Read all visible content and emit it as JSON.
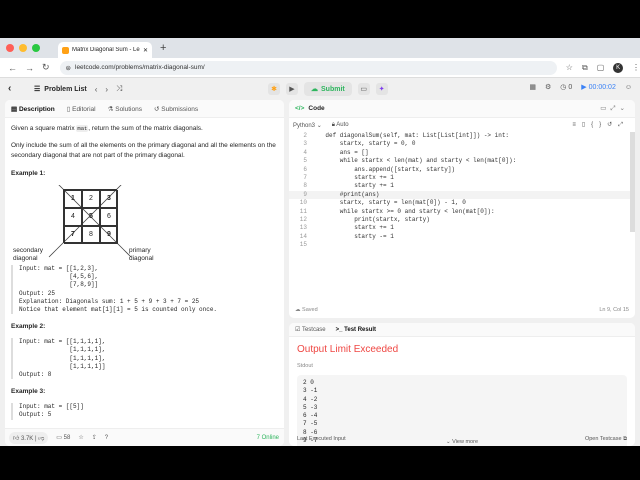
{
  "browser": {
    "tab_title": "Matrix Diagonal Sum - LeetC…",
    "url": "leetcode.com/problems/matrix-diagonal-sum/",
    "avatar_letter": "K"
  },
  "toolbar": {
    "problem_list": "Problem List",
    "submit": "Submit",
    "count": "0",
    "timer": "00:00:02"
  },
  "description": {
    "tabs": [
      "Description",
      "Editorial",
      "Solutions",
      "Submissions"
    ],
    "para1_pre": "Given a square matrix ",
    "para1_code": "mat",
    "para1_post": ", return the sum of the matrix diagonals.",
    "para2": "Only include the sum of all the elements on the primary diagonal and all the elements on the secondary diagonal that are not part of the primary diagonal.",
    "ex1_title": "Example 1:",
    "grid": [
      "1",
      "2",
      "3",
      "4",
      "5",
      "6",
      "7",
      "8",
      "9"
    ],
    "label_secondary": "secondary\ndiagonal",
    "label_primary": "primary\ndiagonal",
    "ex1_input": "Input: mat = [[1,2,3],\n              [4,5,6],\n              [7,8,9]]",
    "ex1_output": "Output: 25",
    "ex1_expl": "Explanation: Diagonals sum: 1 + 5 + 9 + 3 + 7 = 25\nNotice that element mat[1][1] = 5 is counted only once.",
    "ex2_title": "Example 2:",
    "ex2_input": "Input: mat = [[1,1,1,1],\n              [1,1,1,1],\n              [1,1,1,1],\n              [1,1,1,1]]",
    "ex2_output": "Output: 8",
    "ex3_title": "Example 3:",
    "ex3_input": "Input: mat = [[5]]",
    "ex3_output": "Output: 5"
  },
  "left_footer": {
    "likes": "3.7K",
    "comments": "58",
    "online": "7 Online"
  },
  "code": {
    "title": "Code",
    "language": "Python3",
    "auto": "Auto",
    "lines": [
      {
        "n": "2",
        "t": "    def diagonalSum(self, mat: List[List[int]]) -> int:"
      },
      {
        "n": "3",
        "t": "        startx, starty = 0, 0"
      },
      {
        "n": "4",
        "t": "        ans = []"
      },
      {
        "n": "5",
        "t": "        while startx < len(mat) and starty < len(mat[0]):"
      },
      {
        "n": "6",
        "t": "            ans.append([startx, starty])"
      },
      {
        "n": "7",
        "t": "            startx += 1"
      },
      {
        "n": "8",
        "t": "            starty += 1"
      },
      {
        "n": "9",
        "t": "        #print(ans)"
      },
      {
        "n": "10",
        "t": "        startx, starty = len(mat[0]) - 1, 0"
      },
      {
        "n": "11",
        "t": "        while startx >= 0 and starty < len(mat[0]):"
      },
      {
        "n": "12",
        "t": "            print(startx, starty)"
      },
      {
        "n": "13",
        "t": "            startx += 1"
      },
      {
        "n": "14",
        "t": "            starty -= 1"
      },
      {
        "n": "15",
        "t": ""
      }
    ],
    "saved": "Saved",
    "cursor": "Ln 9, Col 15"
  },
  "result": {
    "tab_testcase": "Testcase",
    "tab_result": "Test Result",
    "status": "Output Limit Exceeded",
    "stdout_label": "Stdout",
    "stdout": "2 0\n3 -1\n4 -2\n5 -3\n6 -4\n7 -5\n8 -6\n9 -7",
    "view_more": "View more",
    "last_input": "Last Executed Input",
    "open_testcase": "Open Testcase"
  }
}
